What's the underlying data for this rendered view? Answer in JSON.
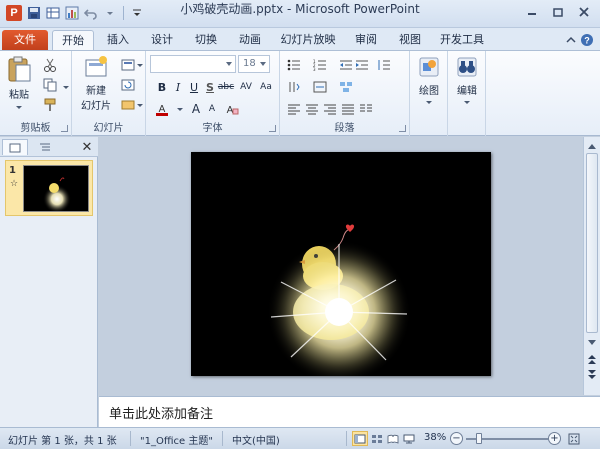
{
  "window": {
    "title": "小鸡破壳动画.pptx  -  Microsoft PowerPoint",
    "app_icon_letter": "P"
  },
  "quick_access": {
    "icons": [
      "save-icon",
      "table-icon",
      "chart-icon",
      "undo-icon",
      "customize-icon"
    ]
  },
  "tabs": [
    {
      "label": "文件",
      "id": "file"
    },
    {
      "label": "开始",
      "id": "home",
      "active": true
    },
    {
      "label": "插入",
      "id": "insert"
    },
    {
      "label": "设计",
      "id": "design"
    },
    {
      "label": "切换",
      "id": "transitions"
    },
    {
      "label": "动画",
      "id": "animations"
    },
    {
      "label": "幻灯片放映",
      "id": "slideshow"
    },
    {
      "label": "审阅",
      "id": "review"
    },
    {
      "label": "视图",
      "id": "view"
    },
    {
      "label": "开发工具",
      "id": "developer"
    }
  ],
  "ribbon": {
    "clipboard": {
      "label": "剪贴板",
      "paste": "粘贴"
    },
    "slides": {
      "label": "幻灯片",
      "new_slide_line1": "新建",
      "new_slide_line2": "幻灯片"
    },
    "font": {
      "label": "字体",
      "font_name": "",
      "font_size": "18"
    },
    "paragraph": {
      "label": "段落"
    },
    "drawing": {
      "label": "绘图"
    },
    "editing": {
      "label": "编辑"
    }
  },
  "thumbnail_pane": {
    "slide_number": "1",
    "star": "☆"
  },
  "notes": {
    "placeholder": "单击此处添加备注"
  },
  "status": {
    "slide_info": "幻灯片 第 1 张，共 1 张",
    "theme": "\"1_Office 主题\"",
    "language": "中文(中国)",
    "zoom": "38%",
    "zoom_level": 0.38
  },
  "colors": {
    "file_tab": "#c2401c",
    "ribbon_bg": "#e6eef8",
    "slide_bg": "#000000"
  }
}
